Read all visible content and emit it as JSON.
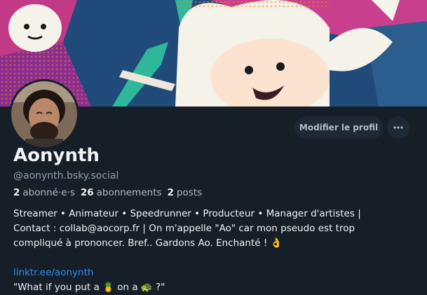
{
  "profile": {
    "display_name": "Aonynth",
    "handle": "@aonynth.bsky.social",
    "stats": {
      "followers_count": "2",
      "followers_label": "abonné·e·s",
      "following_count": "26",
      "following_label": "abonnements",
      "posts_count": "2",
      "posts_label": "posts"
    },
    "bio": {
      "line1": "Streamer • Animateur • Speedrunner • Producteur • Manager d'artistes |",
      "line2": "Contact : collab@aocorp.fr | On m'appelle \"Ao\" car mon pseudo est trop",
      "line3": "compliqué à prononcer. Bref.. Gardons Ao. Enchanté ! 👌",
      "link": "linktr.ee/aonynth",
      "quote": "\"What if you put a 🍍 on a 🐢 ?\""
    }
  },
  "actions": {
    "edit_profile_label": "Modifier le profil",
    "more_icon": "ellipsis-icon"
  },
  "colors": {
    "background": "#161e27",
    "button_bg": "#1e2936",
    "link": "#2f8ef0",
    "muted_text": "#8f9fb0"
  }
}
